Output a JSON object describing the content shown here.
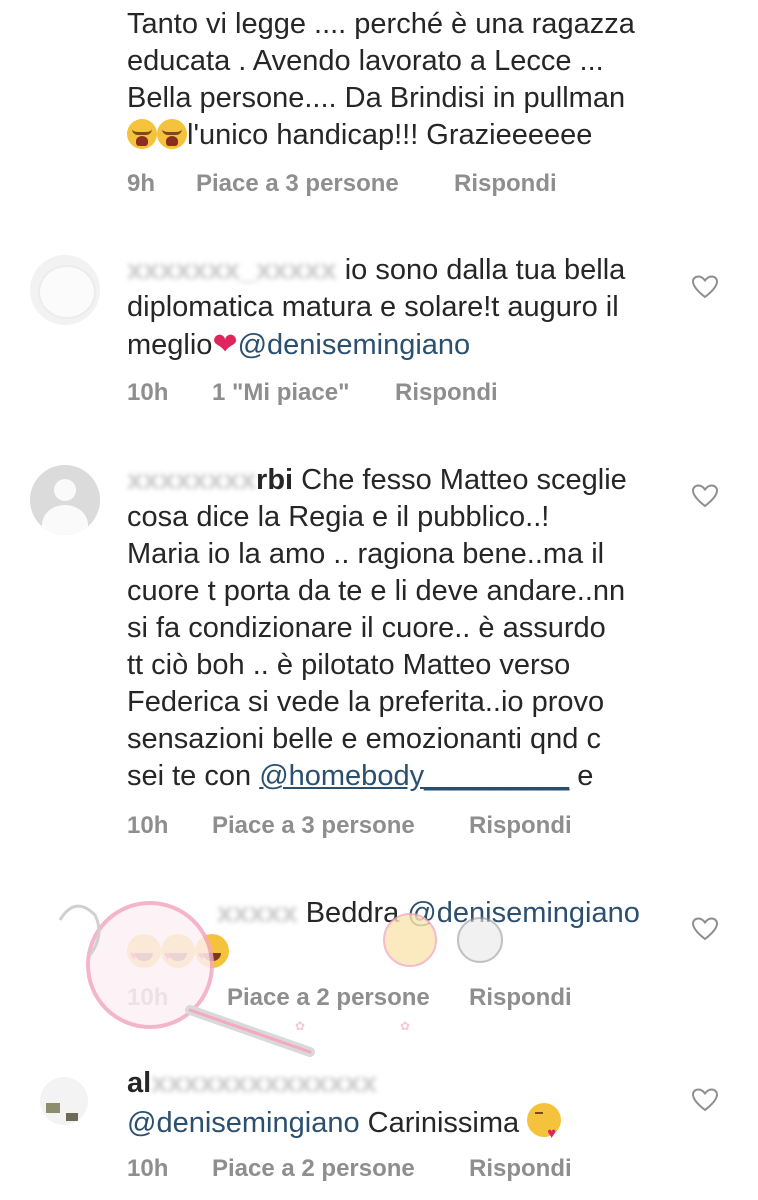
{
  "comments": [
    {
      "avatar": "",
      "username": "",
      "lines": [
        "Tanto vi legge .... perché è una ragazza",
        "educata . Avendo lavorato a Lecce ...",
        "Bella persone.... Da Brindisi in pullman",
        "l'unico handicap!!! Grazieeeeee"
      ],
      "time": "9h",
      "likes": "Piace a 3 persone",
      "reply": "Rispondi"
    },
    {
      "avatar": "faded",
      "username": "io sono dalla tua bella",
      "lines": [
        "diplomatica matura e solare!t auguro il",
        "meglio"
      ],
      "mention": "@denisemingiano",
      "time": "10h",
      "likes": "1 \"Mi piace\"",
      "reply": "Rispondi"
    },
    {
      "avatar": "default",
      "username": "rbi",
      "first_line": "Che fesso Matteo sceglie",
      "lines": [
        "cosa dice la Regia e il pubblico..!",
        "Maria io la amo .. ragiona bene..ma il",
        "cuore t porta da te e li deve andare..nn",
        "si fa condizionare il cuore.. è assurdo",
        "tt ciò boh .. è pilotato Matteo verso",
        "Federica si vede la preferita..io provo",
        "sensazioni belle e emozionanti qnd c"
      ],
      "last_line_prefix": "sei te con",
      "mention": "@homebody_________",
      "last_line_suffix": "e",
      "time": "10h",
      "likes": "Piace a 3 persone",
      "reply": "Rispondi"
    },
    {
      "avatar": "",
      "username": "Beddra",
      "mention": "@denisemingiano",
      "time": "10h",
      "likes": "Piace a 2 persone",
      "reply": "Rispondi"
    },
    {
      "avatar": "small",
      "username": "al",
      "mention": "@denisemingiano",
      "text": "Carinissima",
      "time": "10h",
      "likes": "Piace a 2 persone",
      "reply": "Rispondi"
    }
  ],
  "icons": {
    "like": "heart-outline-icon"
  },
  "colors": {
    "text": "#262626",
    "meta": "#8e8e8e",
    "mention": "#2b4f6e",
    "watermark": "#f4a9c0"
  }
}
